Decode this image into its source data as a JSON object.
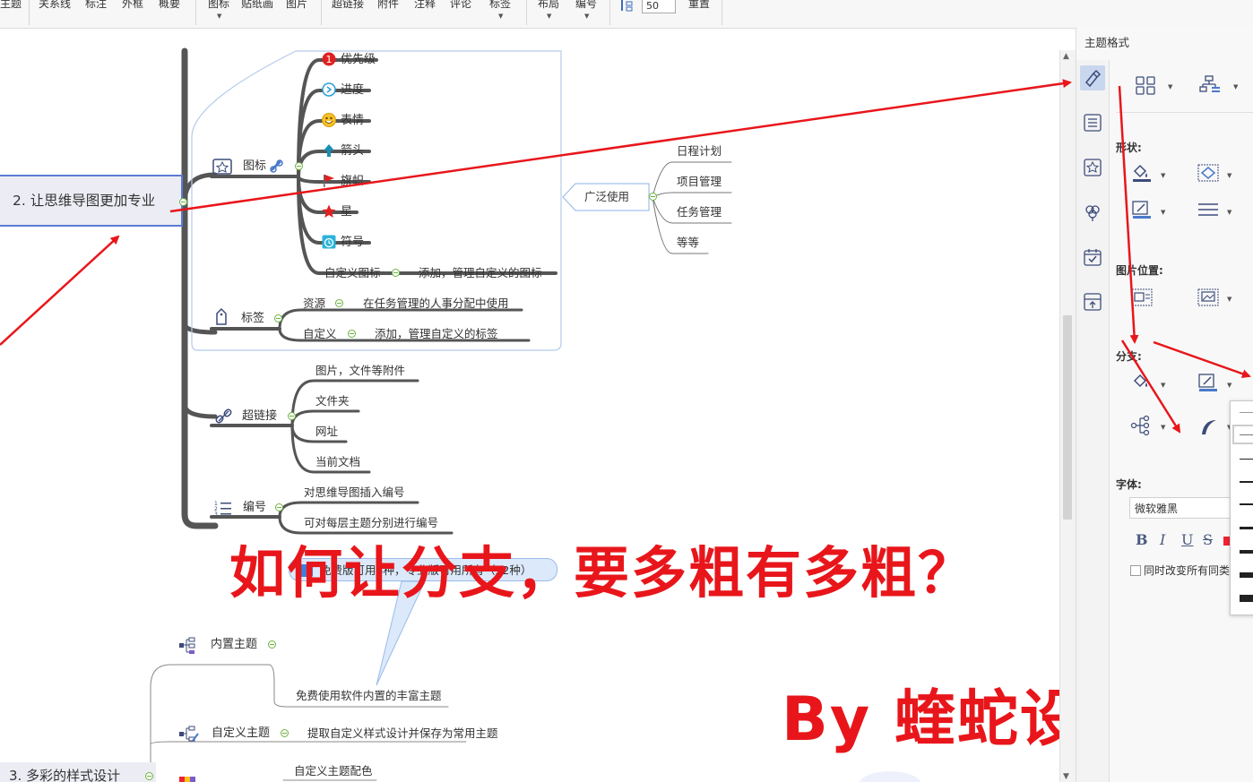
{
  "toolbar": {
    "items": [
      "主题",
      "关系线",
      "标注",
      "外框",
      "概要",
      "图标",
      "贴纸画",
      "图片",
      "超链接",
      "附件",
      "注释",
      "评论",
      "标签",
      "布局",
      "编号",
      "重置"
    ],
    "zoom_value": "50"
  },
  "mindmap": {
    "topic2": "2. 让思维导图更加专业",
    "topic3": "3. 多彩的样式设计",
    "icons_group": {
      "label": "图标",
      "items": [
        "优先级",
        "进度",
        "表情",
        "箭头",
        "旗帜",
        "星",
        "符号"
      ],
      "custom": "自定义图标",
      "custom_desc": "添加，管理自定义的图标"
    },
    "tags_group": {
      "label": "标签",
      "resource": "资源",
      "resource_desc": "在任务管理的人事分配中使用",
      "custom": "自定义",
      "custom_desc": "添加，管理自定义的标签"
    },
    "wide_use": {
      "label": "广泛使用",
      "items": [
        "日程计划",
        "项目管理",
        "任务管理",
        "等等"
      ]
    },
    "hyperlink_group": {
      "label": "超链接",
      "items": [
        "图片，文件等附件",
        "文件夹",
        "网址",
        "当前文档"
      ]
    },
    "numbering_group": {
      "label": "编号",
      "items": [
        "对思维导图插入编号",
        "可对每层主题分别进行编号"
      ]
    },
    "callout": "免费版可用8种，专业版可用所有（32种）",
    "builtin_theme": {
      "label": "内置主题",
      "desc": "免费使用软件内置的丰富主题"
    },
    "custom_theme": {
      "label": "自定义主题",
      "desc": "提取自定义样式设计并保存为常用主题"
    },
    "custom_color": "自定义主题配色"
  },
  "overlay": {
    "headline": "如何让分支，要多粗有多粗？",
    "credit": "By  蝰蛇设计",
    "color": "#e8161b"
  },
  "panel": {
    "title": "主题格式",
    "shape_label": "形状:",
    "image_pos_label": "图片位置:",
    "branch_label": "分支:",
    "font_label": "字体:",
    "font_value": "微软雅黑",
    "format_buttons": [
      "B",
      "I",
      "U",
      "S"
    ],
    "sync_label": "同时改变所有同类"
  }
}
